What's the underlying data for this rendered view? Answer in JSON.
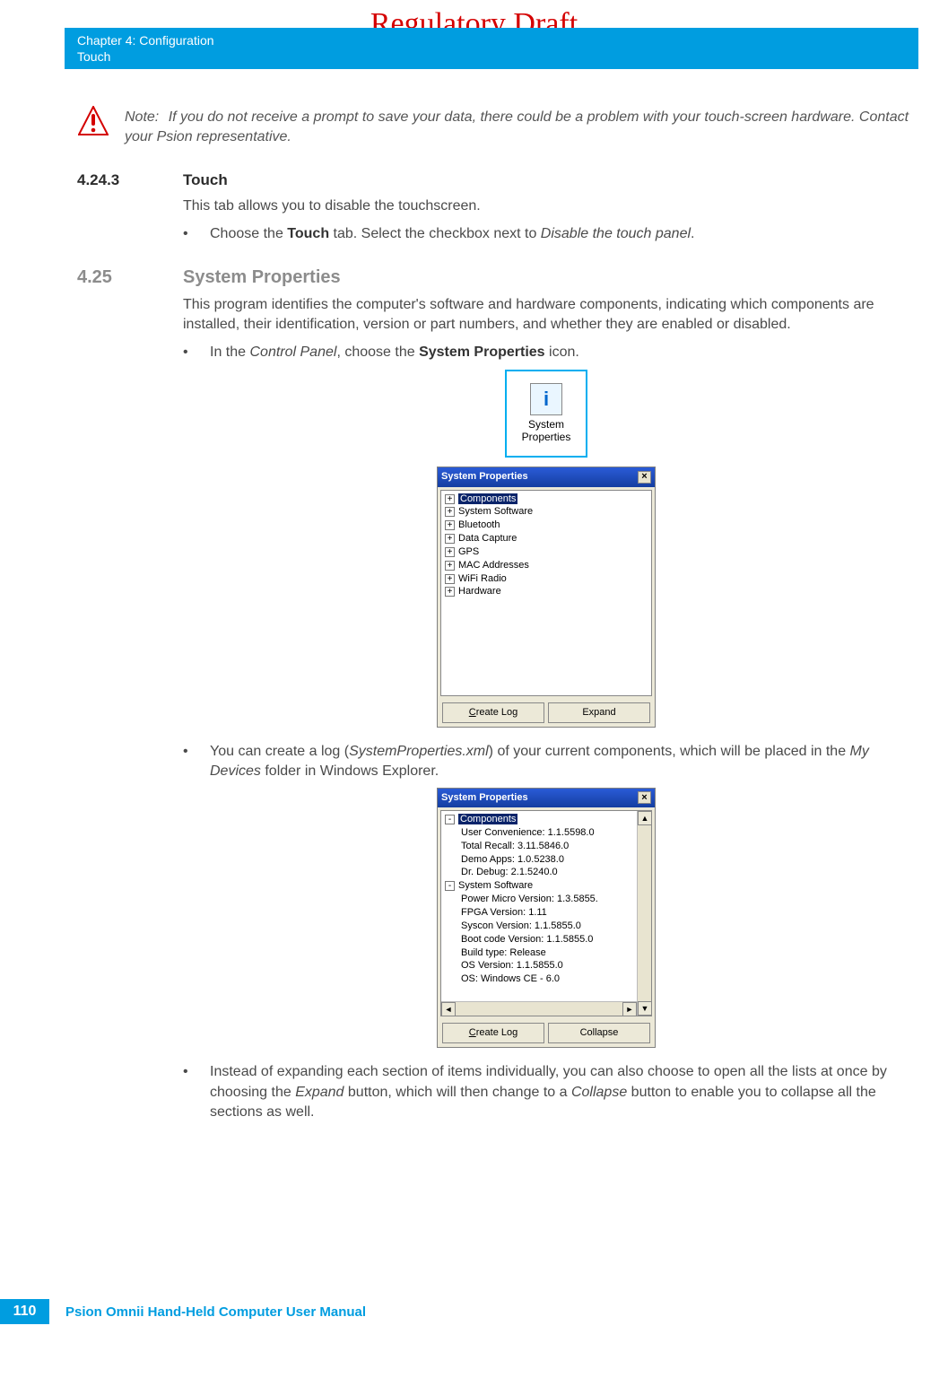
{
  "draft_banner": "Regulatory Draft",
  "header": {
    "chapter": "Chapter 4:  Configuration",
    "section": "Touch"
  },
  "note": {
    "label": "Note:",
    "text": "If you do not receive a prompt to save your data, there could be a problem with your touch-screen hardware. Contact your Psion representative."
  },
  "sec_touch": {
    "num": "4.24.3",
    "title": "Touch",
    "p1": "This tab allows you to disable the touchscreen.",
    "b1_pre": "Choose the ",
    "b1_strong": "Touch",
    "b1_mid": " tab. Select the checkbox next to ",
    "b1_em": "Disable the touch panel",
    "b1_post": "."
  },
  "sec_sysprop": {
    "num": "4.25",
    "title": "System Properties",
    "p1": "This program identifies the computer's software and hardware components, indicating which components are installed, their identification, version or part numbers, and whether they are enabled or disabled.",
    "b1_pre": "In the ",
    "b1_em": "Control Panel",
    "b1_mid": ", choose the ",
    "b1_strong": "System Properties",
    "b1_post": " icon."
  },
  "sp_icon": {
    "line1": "System",
    "line2": "Properties",
    "glyph": "i"
  },
  "dialog1": {
    "title": "System Properties",
    "tree": [
      "Components",
      "System Software",
      "Bluetooth",
      "Data Capture",
      "GPS",
      "MAC Addresses",
      "WiFi Radio",
      "Hardware"
    ],
    "btn_left_u": "C",
    "btn_left_rest": "reate Log",
    "btn_right": "Expand"
  },
  "bullet_log": {
    "pre": "You can create a log (",
    "em1": "SystemProperties.xml",
    "mid": ") of your current components, which will be placed in the ",
    "em2": "My Devices",
    "post": " folder in Windows Explorer."
  },
  "dialog2": {
    "title": "System Properties",
    "tree": [
      {
        "lvl": 0,
        "pm": "-",
        "txt": "Components",
        "sel": true
      },
      {
        "lvl": 1,
        "txt": "User Convenience: 1.1.5598.0"
      },
      {
        "lvl": 1,
        "txt": "Total Recall: 3.11.5846.0"
      },
      {
        "lvl": 1,
        "txt": "Demo Apps: 1.0.5238.0"
      },
      {
        "lvl": 1,
        "txt": "Dr. Debug: 2.1.5240.0"
      },
      {
        "lvl": 0,
        "pm": "-",
        "txt": "System Software"
      },
      {
        "lvl": 1,
        "txt": "Power Micro Version: 1.3.5855."
      },
      {
        "lvl": 1,
        "txt": "FPGA Version: 1.11"
      },
      {
        "lvl": 1,
        "txt": "Syscon Version: 1.1.5855.0"
      },
      {
        "lvl": 1,
        "txt": "Boot code Version: 1.1.5855.0"
      },
      {
        "lvl": 1,
        "txt": "Build type: Release"
      },
      {
        "lvl": 1,
        "txt": "OS Version: 1.1.5855.0"
      },
      {
        "lvl": 1,
        "txt": "OS: Windows CE - 6.0"
      }
    ],
    "btn_left_u": "C",
    "btn_left_rest": "reate Log",
    "btn_right": "Collapse"
  },
  "bullet_expand": {
    "pre": "Instead of expanding each section of items individually, you can also choose to open all the lists at once by choosing the ",
    "em1": "Expand",
    "mid": " button, which will then change to a ",
    "em2": "Collapse",
    "post": " button to enable you to collapse all the sections as well."
  },
  "footer": {
    "page": "110",
    "title": "Psion Omnii Hand-Held Computer User Manual"
  }
}
